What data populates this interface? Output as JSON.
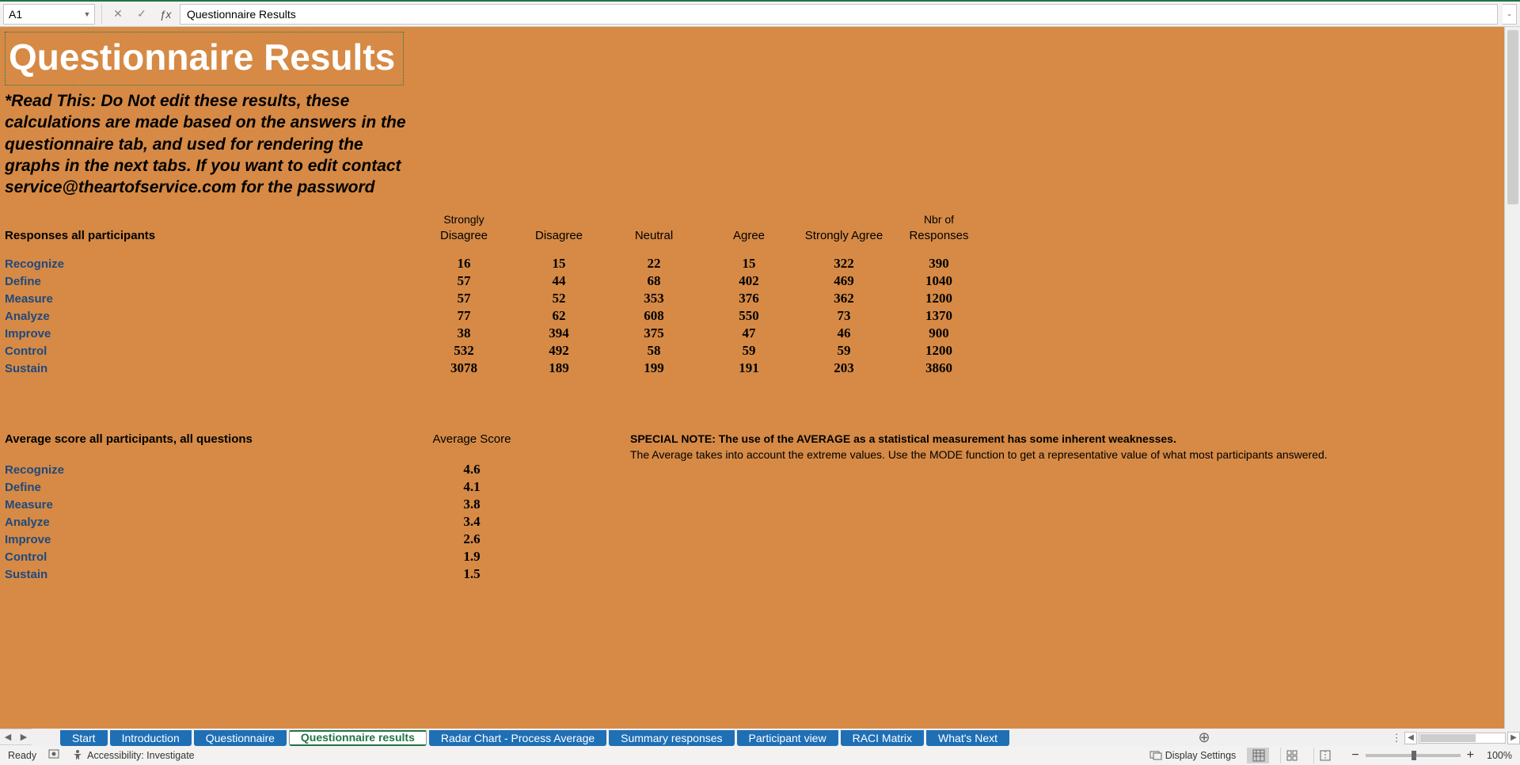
{
  "formula_bar": {
    "cell_ref": "A1",
    "formula_value": "Questionnaire Results"
  },
  "sheet": {
    "title": "Questionnaire Results",
    "read_this": "*Read This: Do Not edit these results, these calculations are made based on the answers in the questionnaire tab, and used for rendering the graphs in the next tabs. If you want to edit contact service@theartofservice.com for the password",
    "responses_heading": "Responses all participants",
    "columns": {
      "c1a": "Strongly",
      "c1b": "Disagree",
      "c2": "Disagree",
      "c3": "Neutral",
      "c4": "Agree",
      "c5": "Strongly Agree",
      "c6a": "Nbr of",
      "c6b": "Responses"
    },
    "rows": [
      {
        "label": "Recognize",
        "v": [
          "16",
          "15",
          "22",
          "15",
          "322",
          "390"
        ]
      },
      {
        "label": "Define",
        "v": [
          "57",
          "44",
          "68",
          "402",
          "469",
          "1040"
        ]
      },
      {
        "label": "Measure",
        "v": [
          "57",
          "52",
          "353",
          "376",
          "362",
          "1200"
        ]
      },
      {
        "label": "Analyze",
        "v": [
          "77",
          "62",
          "608",
          "550",
          "73",
          "1370"
        ]
      },
      {
        "label": "Improve",
        "v": [
          "38",
          "394",
          "375",
          "47",
          "46",
          "900"
        ]
      },
      {
        "label": "Control",
        "v": [
          "532",
          "492",
          "58",
          "59",
          "59",
          "1200"
        ]
      },
      {
        "label": "Sustain",
        "v": [
          "3078",
          "189",
          "199",
          "191",
          "203",
          "3860"
        ]
      }
    ],
    "avg_heading": "Average score all participants, all questions",
    "avg_col_label": "Average Score",
    "avg_rows": [
      {
        "label": "Recognize",
        "v": "4.6"
      },
      {
        "label": "Define",
        "v": "4.1"
      },
      {
        "label": "Measure",
        "v": "3.8"
      },
      {
        "label": "Analyze",
        "v": "3.4"
      },
      {
        "label": "Improve",
        "v": "2.6"
      },
      {
        "label": "Control",
        "v": "1.9"
      },
      {
        "label": "Sustain",
        "v": "1.5"
      }
    ],
    "special_note_bold": "SPECIAL NOTE: The use of the AVERAGE as a statistical measurement has some inherent weaknesses.",
    "special_note_rest": "The Average takes into account the extreme values. Use the MODE function to get a representative value of what most participants answered."
  },
  "tabs": [
    {
      "label": "Start",
      "style": "blue"
    },
    {
      "label": "Introduction",
      "style": "blue"
    },
    {
      "label": "Questionnaire",
      "style": "blue"
    },
    {
      "label": "Questionnaire results",
      "style": "active"
    },
    {
      "label": "Radar Chart - Process Average",
      "style": "blue"
    },
    {
      "label": "Summary responses",
      "style": "blue"
    },
    {
      "label": "Participant view",
      "style": "blue"
    },
    {
      "label": "RACI Matrix",
      "style": "blue"
    },
    {
      "label": "What's Next",
      "style": "blue"
    }
  ],
  "status": {
    "ready": "Ready",
    "accessibility": "Accessibility: Investigate",
    "display_settings": "Display Settings",
    "zoom": "100%"
  },
  "chart_data": [
    {
      "type": "table",
      "title": "Responses all participants",
      "categories": [
        "Recognize",
        "Define",
        "Measure",
        "Analyze",
        "Improve",
        "Control",
        "Sustain"
      ],
      "series": [
        {
          "name": "Strongly Disagree",
          "values": [
            16,
            57,
            57,
            77,
            38,
            532,
            3078
          ]
        },
        {
          "name": "Disagree",
          "values": [
            15,
            44,
            52,
            62,
            394,
            492,
            189
          ]
        },
        {
          "name": "Neutral",
          "values": [
            22,
            68,
            353,
            608,
            375,
            58,
            199
          ]
        },
        {
          "name": "Agree",
          "values": [
            15,
            402,
            376,
            550,
            47,
            59,
            191
          ]
        },
        {
          "name": "Strongly Agree",
          "values": [
            322,
            469,
            362,
            73,
            46,
            59,
            203
          ]
        },
        {
          "name": "Nbr of Responses",
          "values": [
            390,
            1040,
            1200,
            1370,
            900,
            1200,
            3860
          ]
        }
      ]
    },
    {
      "type": "table",
      "title": "Average score all participants, all questions",
      "categories": [
        "Recognize",
        "Define",
        "Measure",
        "Analyze",
        "Improve",
        "Control",
        "Sustain"
      ],
      "series": [
        {
          "name": "Average Score",
          "values": [
            4.6,
            4.1,
            3.8,
            3.4,
            2.6,
            1.9,
            1.5
          ]
        }
      ]
    }
  ]
}
